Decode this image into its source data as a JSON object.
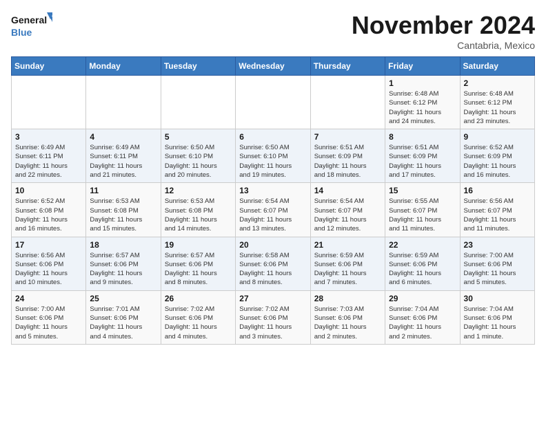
{
  "logo": {
    "general": "General",
    "blue": "Blue"
  },
  "title": "November 2024",
  "location": "Cantabria, Mexico",
  "days_of_week": [
    "Sunday",
    "Monday",
    "Tuesday",
    "Wednesday",
    "Thursday",
    "Friday",
    "Saturday"
  ],
  "weeks": [
    [
      {
        "day": "",
        "info": ""
      },
      {
        "day": "",
        "info": ""
      },
      {
        "day": "",
        "info": ""
      },
      {
        "day": "",
        "info": ""
      },
      {
        "day": "",
        "info": ""
      },
      {
        "day": "1",
        "info": "Sunrise: 6:48 AM\nSunset: 6:12 PM\nDaylight: 11 hours\nand 24 minutes."
      },
      {
        "day": "2",
        "info": "Sunrise: 6:48 AM\nSunset: 6:12 PM\nDaylight: 11 hours\nand 23 minutes."
      }
    ],
    [
      {
        "day": "3",
        "info": "Sunrise: 6:49 AM\nSunset: 6:11 PM\nDaylight: 11 hours\nand 22 minutes."
      },
      {
        "day": "4",
        "info": "Sunrise: 6:49 AM\nSunset: 6:11 PM\nDaylight: 11 hours\nand 21 minutes."
      },
      {
        "day": "5",
        "info": "Sunrise: 6:50 AM\nSunset: 6:10 PM\nDaylight: 11 hours\nand 20 minutes."
      },
      {
        "day": "6",
        "info": "Sunrise: 6:50 AM\nSunset: 6:10 PM\nDaylight: 11 hours\nand 19 minutes."
      },
      {
        "day": "7",
        "info": "Sunrise: 6:51 AM\nSunset: 6:09 PM\nDaylight: 11 hours\nand 18 minutes."
      },
      {
        "day": "8",
        "info": "Sunrise: 6:51 AM\nSunset: 6:09 PM\nDaylight: 11 hours\nand 17 minutes."
      },
      {
        "day": "9",
        "info": "Sunrise: 6:52 AM\nSunset: 6:09 PM\nDaylight: 11 hours\nand 16 minutes."
      }
    ],
    [
      {
        "day": "10",
        "info": "Sunrise: 6:52 AM\nSunset: 6:08 PM\nDaylight: 11 hours\nand 16 minutes."
      },
      {
        "day": "11",
        "info": "Sunrise: 6:53 AM\nSunset: 6:08 PM\nDaylight: 11 hours\nand 15 minutes."
      },
      {
        "day": "12",
        "info": "Sunrise: 6:53 AM\nSunset: 6:08 PM\nDaylight: 11 hours\nand 14 minutes."
      },
      {
        "day": "13",
        "info": "Sunrise: 6:54 AM\nSunset: 6:07 PM\nDaylight: 11 hours\nand 13 minutes."
      },
      {
        "day": "14",
        "info": "Sunrise: 6:54 AM\nSunset: 6:07 PM\nDaylight: 11 hours\nand 12 minutes."
      },
      {
        "day": "15",
        "info": "Sunrise: 6:55 AM\nSunset: 6:07 PM\nDaylight: 11 hours\nand 11 minutes."
      },
      {
        "day": "16",
        "info": "Sunrise: 6:56 AM\nSunset: 6:07 PM\nDaylight: 11 hours\nand 11 minutes."
      }
    ],
    [
      {
        "day": "17",
        "info": "Sunrise: 6:56 AM\nSunset: 6:06 PM\nDaylight: 11 hours\nand 10 minutes."
      },
      {
        "day": "18",
        "info": "Sunrise: 6:57 AM\nSunset: 6:06 PM\nDaylight: 11 hours\nand 9 minutes."
      },
      {
        "day": "19",
        "info": "Sunrise: 6:57 AM\nSunset: 6:06 PM\nDaylight: 11 hours\nand 8 minutes."
      },
      {
        "day": "20",
        "info": "Sunrise: 6:58 AM\nSunset: 6:06 PM\nDaylight: 11 hours\nand 8 minutes."
      },
      {
        "day": "21",
        "info": "Sunrise: 6:59 AM\nSunset: 6:06 PM\nDaylight: 11 hours\nand 7 minutes."
      },
      {
        "day": "22",
        "info": "Sunrise: 6:59 AM\nSunset: 6:06 PM\nDaylight: 11 hours\nand 6 minutes."
      },
      {
        "day": "23",
        "info": "Sunrise: 7:00 AM\nSunset: 6:06 PM\nDaylight: 11 hours\nand 5 minutes."
      }
    ],
    [
      {
        "day": "24",
        "info": "Sunrise: 7:00 AM\nSunset: 6:06 PM\nDaylight: 11 hours\nand 5 minutes."
      },
      {
        "day": "25",
        "info": "Sunrise: 7:01 AM\nSunset: 6:06 PM\nDaylight: 11 hours\nand 4 minutes."
      },
      {
        "day": "26",
        "info": "Sunrise: 7:02 AM\nSunset: 6:06 PM\nDaylight: 11 hours\nand 4 minutes."
      },
      {
        "day": "27",
        "info": "Sunrise: 7:02 AM\nSunset: 6:06 PM\nDaylight: 11 hours\nand 3 minutes."
      },
      {
        "day": "28",
        "info": "Sunrise: 7:03 AM\nSunset: 6:06 PM\nDaylight: 11 hours\nand 2 minutes."
      },
      {
        "day": "29",
        "info": "Sunrise: 7:04 AM\nSunset: 6:06 PM\nDaylight: 11 hours\nand 2 minutes."
      },
      {
        "day": "30",
        "info": "Sunrise: 7:04 AM\nSunset: 6:06 PM\nDaylight: 11 hours\nand 1 minute."
      }
    ]
  ]
}
